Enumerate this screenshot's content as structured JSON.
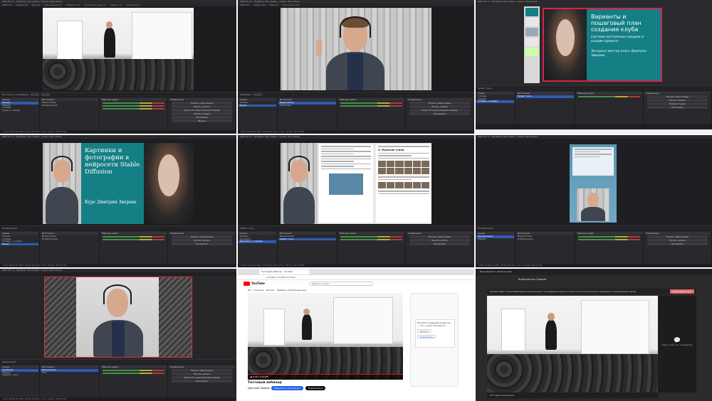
{
  "colors": {
    "obs_bg": "#1f1f23",
    "obs_selected": "#2f5ab3",
    "teal_slide": "#147f85",
    "youtube_red": "#ff0000",
    "join_button": "#e46a6a"
  },
  "obs": {
    "title": "OBS 29.1.3 - Профиль: Без имени - Сцены: Без имени",
    "menu": [
      "Файл (F)",
      "Правка (E)",
      "Вид (V)",
      "Док-панели (D)",
      "Профиль (P)",
      "Коллекция сцен (S)",
      "Сервис (T)",
      "Справка (H)"
    ],
    "pane_scenes": "Сцены",
    "pane_sources": "Источники",
    "pane_mixer": "Микшер аудио",
    "pane_controls": "Управление",
    "controls": [
      "Начать трансляцию",
      "Начать запись",
      "Запустить виртуальную камеру",
      "Режим студии",
      "Настройки",
      "Выход"
    ],
    "status": "LIVE: 00:00:00  REC: 00:00:00  CPU: 1.5%, 30.00 / 30.00 FPS"
  },
  "panels": [
    {
      "scenes": [
        "Лекция",
        "Камера",
        "Слайды",
        "Экран + камера"
      ],
      "sources": [
        "Видеозахват",
        "Изображение"
      ],
      "bar_label": "Источники не выбраны"
    },
    {
      "scenes": [
        "Камера",
        "Видео"
      ],
      "sources": [
        "Видеозахват",
        "Микрофон"
      ],
      "bar_label": "Микрофон"
    },
    {
      "scenes": [
        "Слайды",
        "Камера",
        "Слайды + камера"
      ],
      "sources": [
        "Захват окна"
      ],
      "bar_label": "Захват окна"
    },
    {
      "scenes": [
        "Камера",
        "Слайды",
        "Слайды + камера",
        "Экран"
      ],
      "sources": [
        "Видеозахват",
        "Изображение"
      ],
      "bar_label": "Изображение"
    },
    {
      "scenes": [
        "Камера",
        "Документ",
        "Документ + камера"
      ],
      "sources": [
        "Видеозахват",
        "Захват окна"
      ],
      "bar_label": "Захват окна"
    },
    {
      "scenes": [
        "Презентация",
        "Камера"
      ],
      "sources": [
        "Видеозахват",
        "Изображение"
      ],
      "bar_label": "Изображение"
    },
    {
      "scenes": [
        "Хромакей",
        "Камера",
        "Камера + фон"
      ],
      "sources": [
        "Видеозахват",
        "Фон"
      ],
      "bar_label": "Видеозахват"
    }
  ],
  "slides": {
    "club_title": "Варианты и пошаговый план создания клуба",
    "club_subtitle": "Система постоянных продаж в онлайн-проекте",
    "club_author": "Экспресс-мастер-класс Дмитрия Зверева",
    "sd_title": "Картинки и фотографии в нейросети Stable Diffusion",
    "sd_author": "Курс Дмитрия Зверева",
    "doc_heading": "5. Мужские стили"
  },
  "youtube": {
    "tab": "Тестовый вебинар - YouTube",
    "url": "youtube.com/watch?v=live",
    "logo": "YouTube",
    "search_placeholder": "Введите запрос",
    "chips": [
      "Все",
      "Похожее",
      "Для вас",
      "Недавно опубликованные"
    ],
    "video_title": "Тестовый вебинар",
    "channel": "Дмитрий Зверев",
    "subscribe": "Подписаться",
    "join": "Оформить спонсорство",
    "poll_title": "Нажмите! Будущий вопросик — что у школ Тестового?",
    "poll_options": [
      "Купить",
      "Подождать"
    ],
    "time": "0:00 / 1:12:45"
  },
  "telegram": {
    "window": "Видеоформат. Прямой эфир",
    "header": "Видеозвонок Прямой",
    "banner": "Прямой эфир: Наша вебинарная презентация, посвящённая запуску клуба по итогам прошлых семинаров и дальнейшим шагам",
    "join_label": "Присоединиться",
    "footer": "Тестовая трансляция",
    "chat_empty": "Здесь пока нет сообщений"
  }
}
